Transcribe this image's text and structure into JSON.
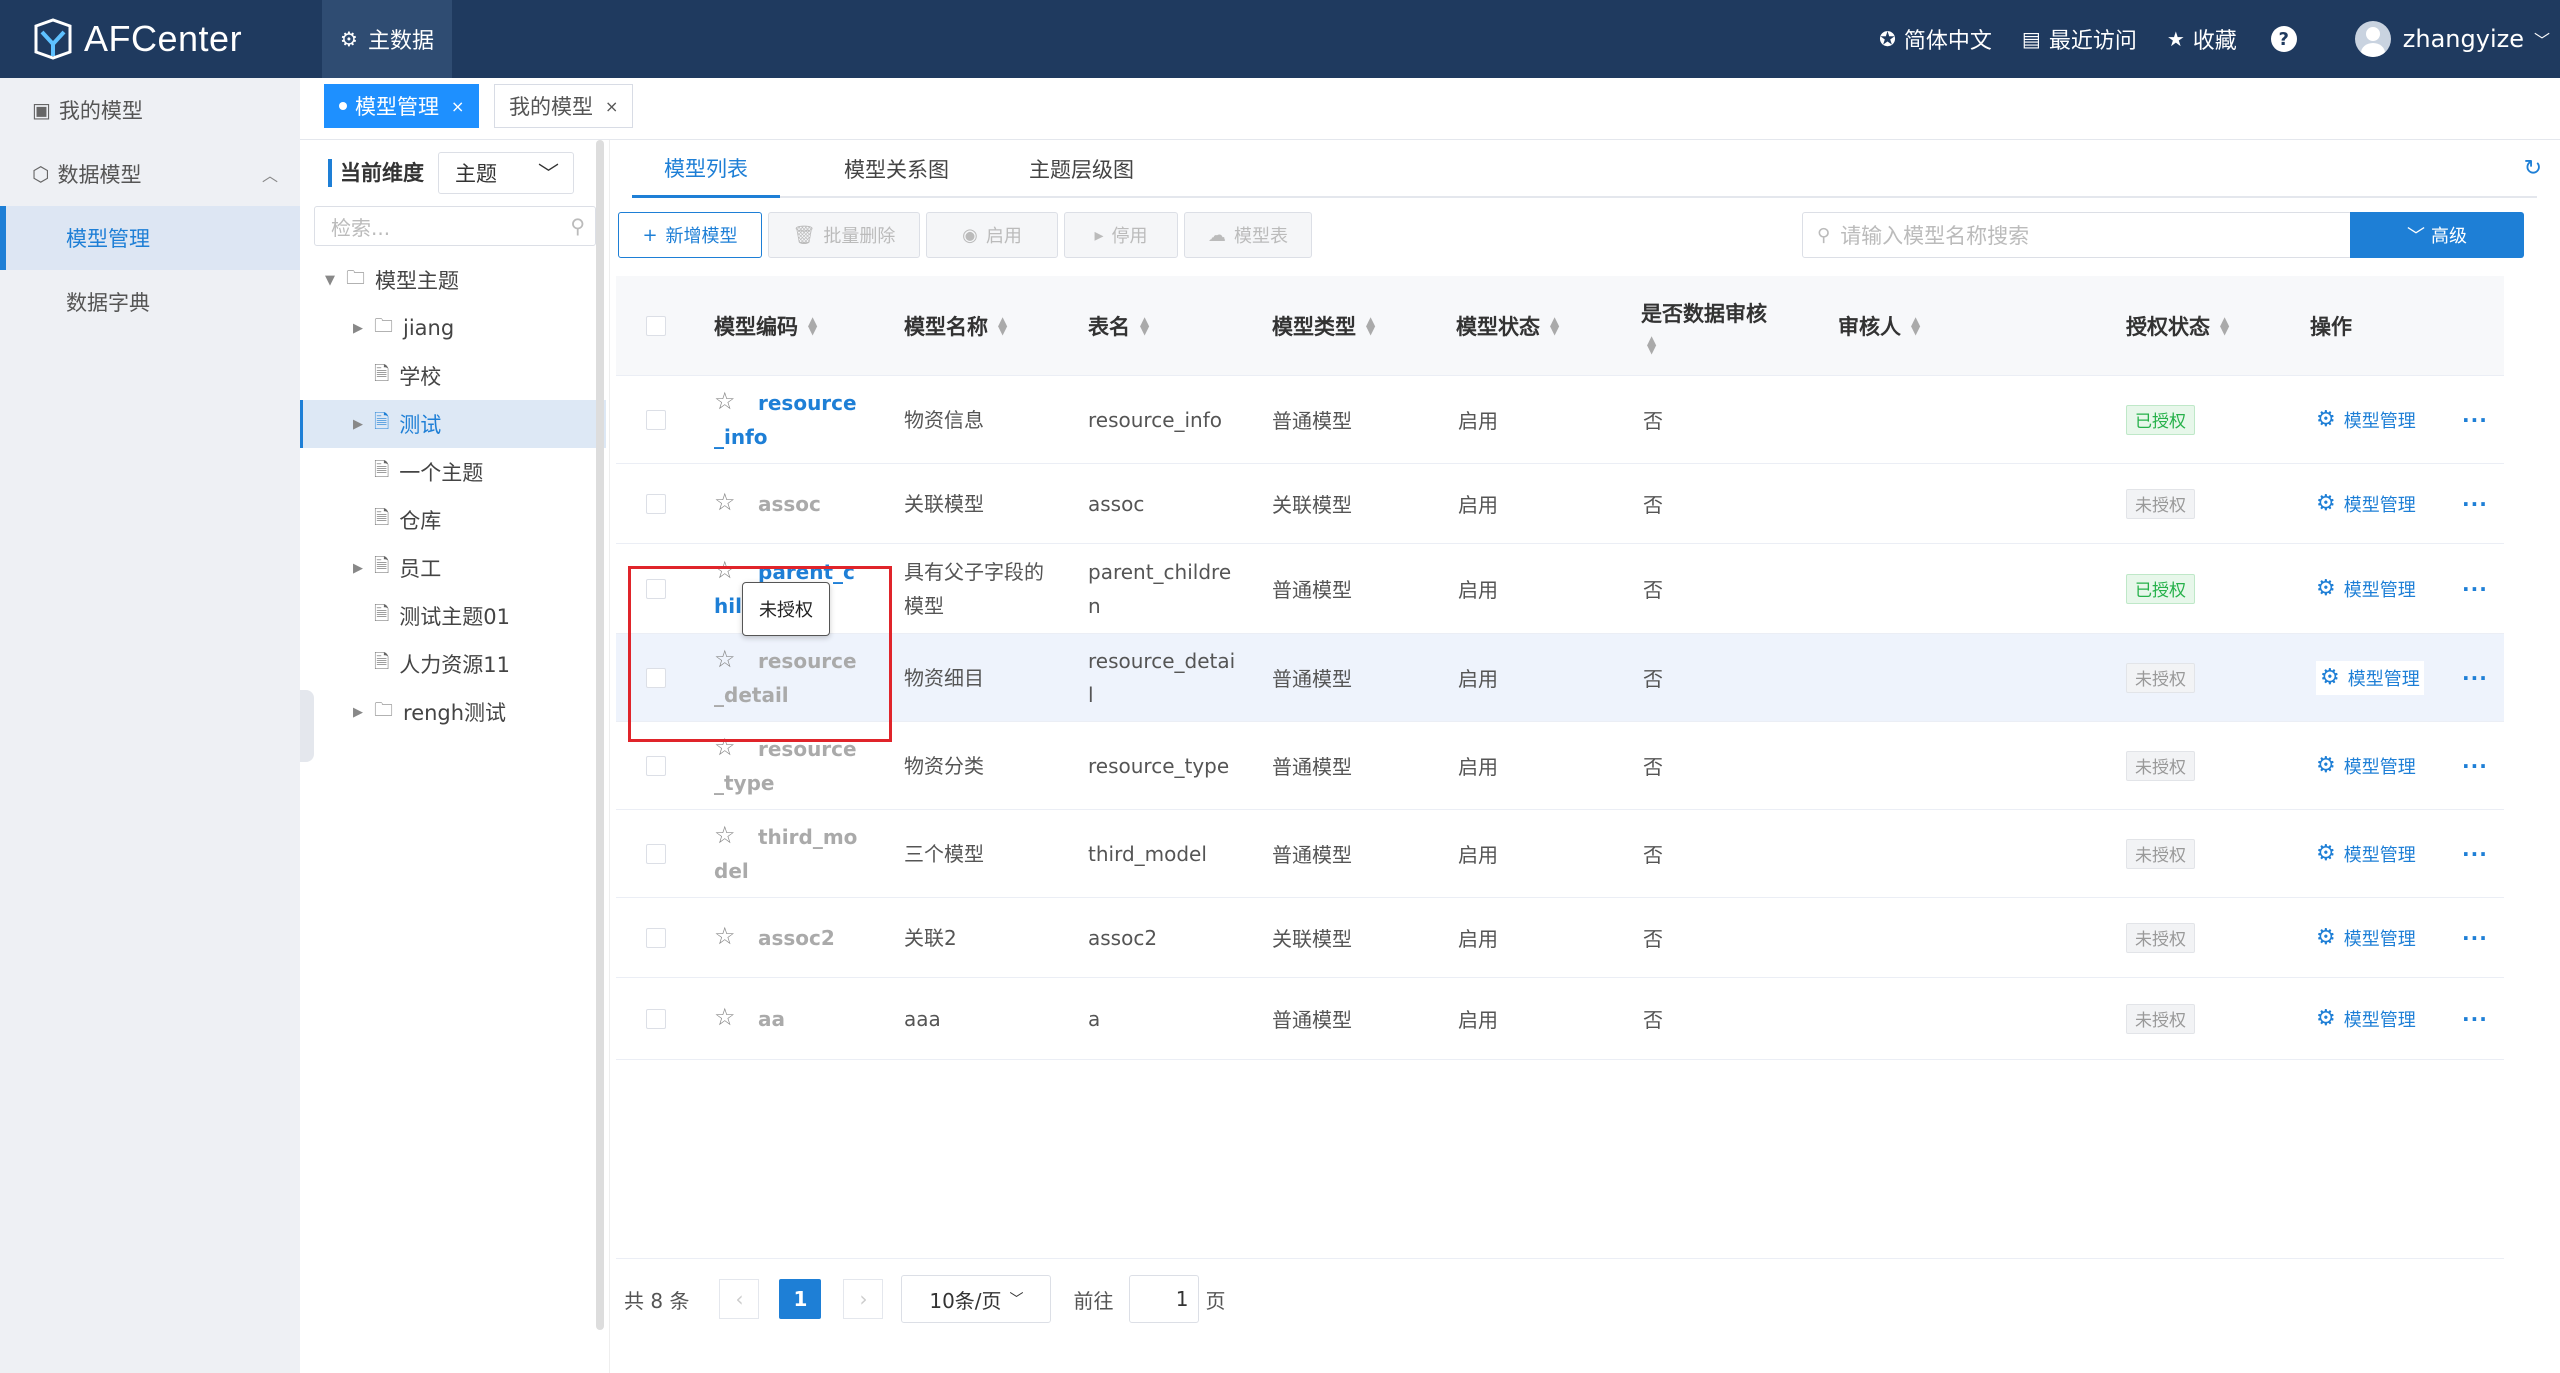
{
  "app": {
    "name": "AFCenter",
    "top_tab": "主数据"
  },
  "topbar": {
    "language": "简体中文",
    "recent": "最近访问",
    "favorites": "收藏",
    "help": "?",
    "username": "zhangyize"
  },
  "sidebar": {
    "items": [
      {
        "label": "我的模型"
      },
      {
        "label": "数据模型"
      }
    ],
    "sub_items": [
      {
        "label": "模型管理",
        "active": true
      },
      {
        "label": "数据字典",
        "active": false
      }
    ]
  },
  "page_tabs": [
    {
      "label": "模型管理",
      "active": true
    },
    {
      "label": "我的模型",
      "active": false
    }
  ],
  "tree_panel": {
    "dimension_label": "当前维度",
    "dimension_value": "主题",
    "search_placeholder": "检索...",
    "nodes": [
      {
        "label": "模型主题",
        "type": "folder",
        "level": 0,
        "toggle": "down"
      },
      {
        "label": "jiang",
        "type": "folder",
        "level": 1,
        "toggle": "right"
      },
      {
        "label": "学校",
        "type": "file",
        "level": 1,
        "toggle": ""
      },
      {
        "label": "测试",
        "type": "file",
        "level": 1,
        "toggle": "right",
        "selected": true
      },
      {
        "label": "一个主题",
        "type": "file",
        "level": 1,
        "toggle": ""
      },
      {
        "label": "仓库",
        "type": "file",
        "level": 1,
        "toggle": ""
      },
      {
        "label": "员工",
        "type": "file",
        "level": 1,
        "toggle": "right"
      },
      {
        "label": "测试主题01",
        "type": "file",
        "level": 1,
        "toggle": ""
      },
      {
        "label": "人力资源11",
        "type": "file",
        "level": 1,
        "toggle": ""
      },
      {
        "label": "rengh测试",
        "type": "folder",
        "level": 1,
        "toggle": "right"
      }
    ]
  },
  "main_tabs": [
    {
      "label": "模型列表",
      "active": true
    },
    {
      "label": "模型关系图",
      "active": false
    },
    {
      "label": "主题层级图",
      "active": false
    }
  ],
  "toolbar": {
    "add": "新增模型",
    "batch_delete": "批量删除",
    "enable": "启用",
    "disable": "停用",
    "model_table": "模型表",
    "search_placeholder": "请输入模型名称搜索",
    "advanced": "高级"
  },
  "table": {
    "headers": {
      "code": "模型编码",
      "name": "模型名称",
      "table_name": "表名",
      "type": "模型类型",
      "status": "模型状态",
      "audit": "是否数据审核",
      "auditor": "审核人",
      "auth": "授权状态",
      "ops": "操作"
    },
    "rows": [
      {
        "code": "resource_info",
        "name": "物资信息",
        "table_name": "resource_info",
        "type": "普通模型",
        "status": "启用",
        "audit": "否",
        "auditor": "",
        "auth": "已授权",
        "op": "模型管理"
      },
      {
        "code": "assoc",
        "name": "关联模型",
        "table_name": "assoc",
        "type": "关联模型",
        "status": "启用",
        "audit": "否",
        "auditor": "",
        "auth": "未授权",
        "op": "模型管理"
      },
      {
        "code": "parent_children",
        "name": "具有父子字段的模型",
        "table_name": "parent_children",
        "type": "普通模型",
        "status": "启用",
        "audit": "否",
        "auditor": "",
        "auth": "已授权",
        "op": "模型管理"
      },
      {
        "code": "resource_detail",
        "name": "物资细目",
        "table_name": "resource_detail",
        "type": "普通模型",
        "status": "启用",
        "audit": "否",
        "auditor": "",
        "auth": "未授权",
        "op": "模型管理"
      },
      {
        "code": "resource_type",
        "name": "物资分类",
        "table_name": "resource_type",
        "type": "普通模型",
        "status": "启用",
        "audit": "否",
        "auditor": "",
        "auth": "未授权",
        "op": "模型管理"
      },
      {
        "code": "third_model",
        "name": "三个模型",
        "table_name": "third_model",
        "type": "普通模型",
        "status": "启用",
        "audit": "否",
        "auditor": "",
        "auth": "未授权",
        "op": "模型管理"
      },
      {
        "code": "assoc2",
        "name": "关联2",
        "table_name": "assoc2",
        "type": "关联模型",
        "status": "启用",
        "audit": "否",
        "auditor": "",
        "auth": "未授权",
        "op": "模型管理"
      },
      {
        "code": "aa",
        "name": "aaa",
        "table_name": "a",
        "type": "普通模型",
        "status": "启用",
        "audit": "否",
        "auditor": "",
        "auth": "未授权",
        "op": "模型管理"
      }
    ]
  },
  "tooltip": {
    "text": "未授权"
  },
  "pagination": {
    "total": "共 8 条",
    "current_page": "1",
    "page_size": "10条/页",
    "goto_prefix": "前往",
    "goto_value": "1",
    "goto_suffix": "页"
  },
  "colors": {
    "topbar": "#1f3a5f",
    "accent": "#1e7fd6",
    "highlight_box": "#e0242a",
    "authorized": "#26b14a"
  }
}
